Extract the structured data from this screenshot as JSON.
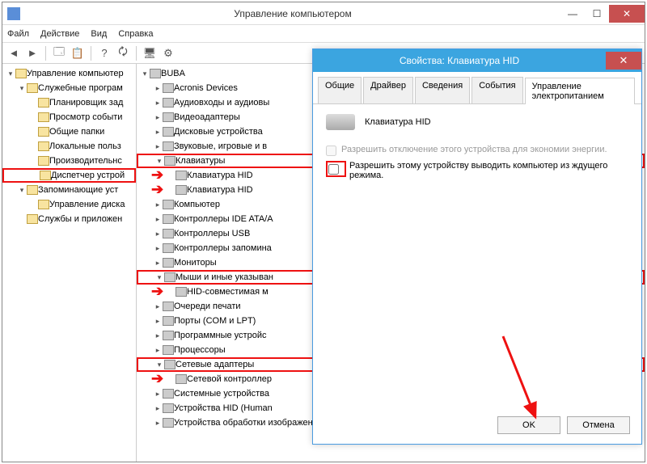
{
  "window": {
    "title": "Управление компьютером",
    "menu": {
      "file": "Файл",
      "action": "Действие",
      "view": "Вид",
      "help": "Справка"
    },
    "buttons": {
      "min": "—",
      "max": "☐",
      "close": "✕"
    }
  },
  "left_tree": {
    "root": "Управление компьютер",
    "items": [
      {
        "label": "Служебные програм",
        "expanded": true,
        "children": [
          {
            "label": "Планировщик зад"
          },
          {
            "label": "Просмотр событи"
          },
          {
            "label": "Общие папки"
          },
          {
            "label": "Локальные польз"
          },
          {
            "label": "Производительнс"
          },
          {
            "label": "Диспетчер устрой",
            "highlighted": true
          }
        ]
      },
      {
        "label": "Запоминающие уст",
        "expanded": true,
        "children": [
          {
            "label": "Управление диска"
          }
        ]
      },
      {
        "label": "Службы и приложен"
      }
    ]
  },
  "device_tree": {
    "root": "BUBA",
    "items": [
      {
        "label": "Acronis Devices"
      },
      {
        "label": "Аудиовходы и аудиовы"
      },
      {
        "label": "Видеоадаптеры"
      },
      {
        "label": "Дисковые устройства"
      },
      {
        "label": "Звуковые, игровые и в"
      },
      {
        "label": "Клавиатуры",
        "highlighted": true,
        "expanded": true,
        "children": [
          {
            "label": "Клавиатура HID",
            "arrow": true
          },
          {
            "label": "Клавиатура HID",
            "arrow": true
          }
        ]
      },
      {
        "label": "Компьютер"
      },
      {
        "label": "Контроллеры IDE ATA/A"
      },
      {
        "label": "Контроллеры USB"
      },
      {
        "label": "Контроллеры запомина"
      },
      {
        "label": "Мониторы"
      },
      {
        "label": "Мыши и иные указыван",
        "highlighted": true,
        "expanded": true,
        "children": [
          {
            "label": "HID-совместимая м",
            "arrow": true
          }
        ]
      },
      {
        "label": "Очереди печати"
      },
      {
        "label": "Порты (COM и LPT)"
      },
      {
        "label": "Программные устройс"
      },
      {
        "label": "Процессоры"
      },
      {
        "label": "Сетевые адаптеры",
        "highlighted": true,
        "expanded": true,
        "children": [
          {
            "label": "Сетевой контроллер",
            "arrow": true
          }
        ]
      },
      {
        "label": "Системные устройства"
      },
      {
        "label": "Устройства HID (Human"
      },
      {
        "label": "Устройства обработки изображений"
      }
    ]
  },
  "dialog": {
    "title": "Свойства: Клавиатура HID",
    "close": "✕",
    "tabs": {
      "general": "Общие",
      "driver": "Драйвер",
      "details": "Сведения",
      "events": "События",
      "power": "Управление электропитанием"
    },
    "active_tab": "power",
    "device_name": "Клавиатура HID",
    "checkbox1": "Разрешить отключение этого устройства для экономии энергии.",
    "checkbox2": "Разрешить этому устройству выводить компьютер из ждущего режима.",
    "ok": "OK",
    "cancel": "Отмена"
  }
}
